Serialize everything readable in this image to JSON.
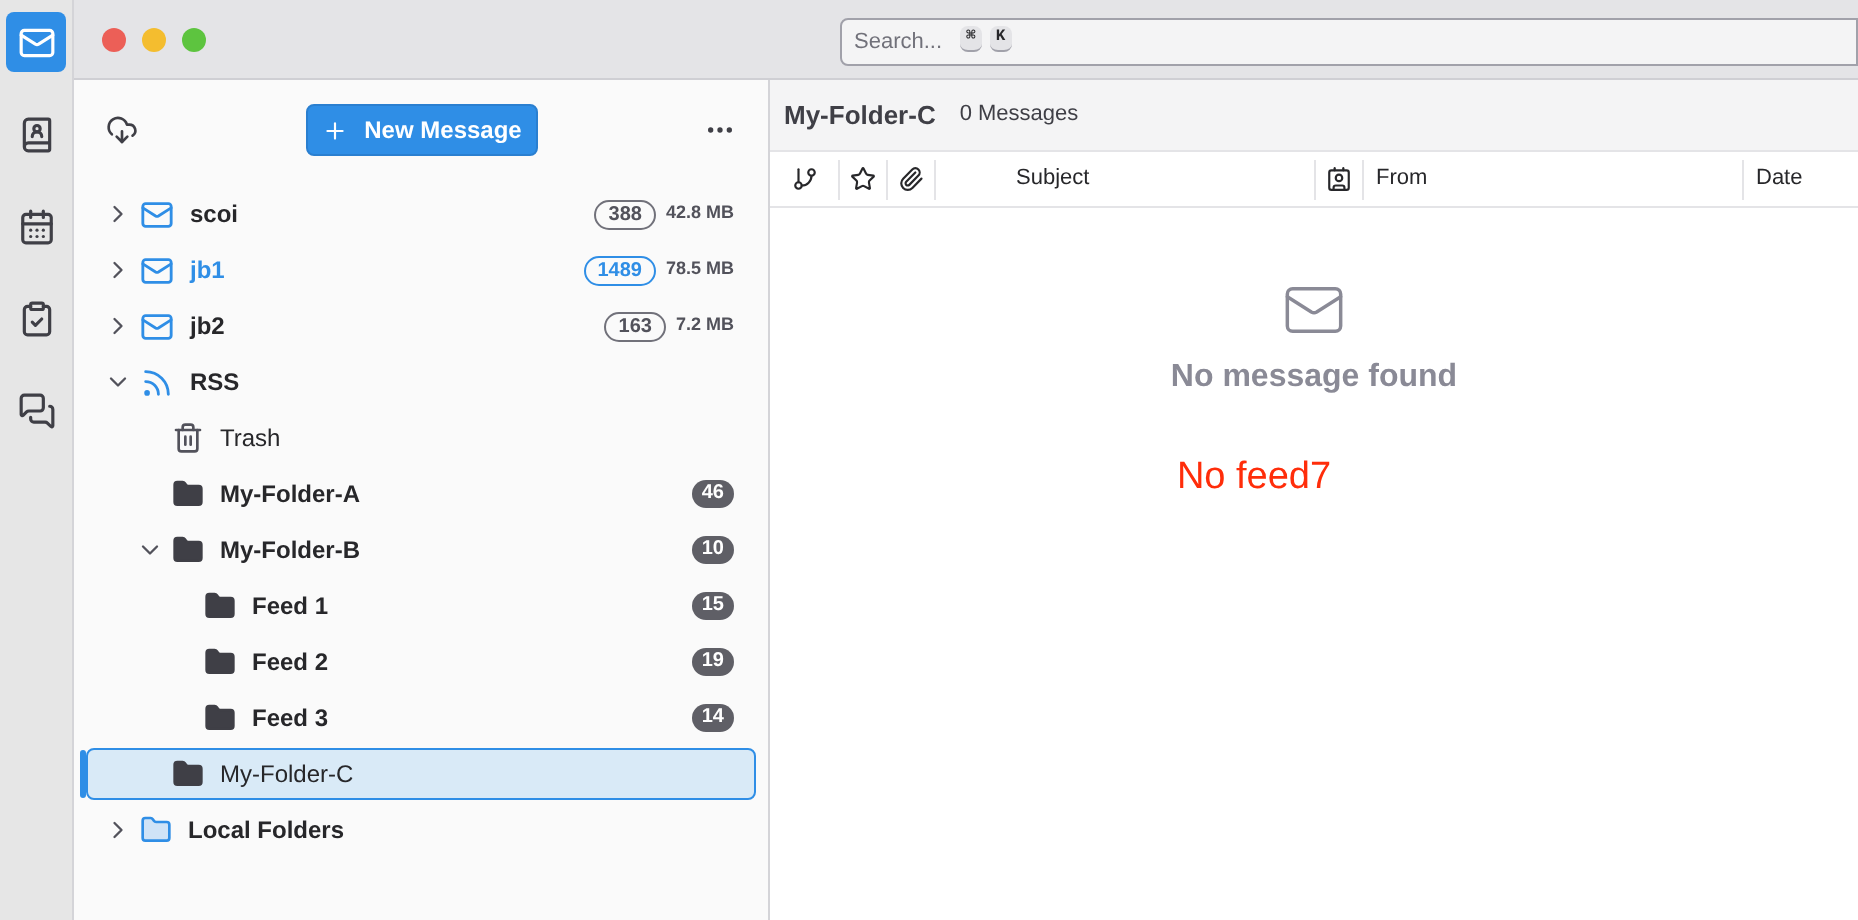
{
  "spaces": [
    {
      "kind": "mail",
      "selected": true
    },
    {
      "kind": "contacts",
      "selected": false
    },
    {
      "kind": "calendar",
      "selected": false
    },
    {
      "kind": "tasks",
      "selected": false
    },
    {
      "kind": "chat",
      "selected": false
    }
  ],
  "search": {
    "placeholder": "Search...",
    "keys": [
      "⌘",
      "K"
    ]
  },
  "folder_pane": {
    "new_message_button": "New Message"
  },
  "tree": [
    {
      "kind": "account",
      "name": "scoi",
      "expanded": false,
      "selected": false,
      "new_mail": false,
      "count": "388",
      "size": "42.8 MB"
    },
    {
      "kind": "account",
      "name": "jb1",
      "expanded": false,
      "selected": false,
      "new_mail": true,
      "count": "1489",
      "size": "78.5 MB"
    },
    {
      "kind": "account",
      "name": "jb2",
      "expanded": false,
      "selected": false,
      "new_mail": false,
      "count": "163",
      "size": "7.2 MB"
    },
    {
      "kind": "rss",
      "name": "RSS",
      "expanded": true,
      "selected": false,
      "new_mail": false,
      "children": [
        {
          "kind": "trash",
          "name": "Trash",
          "selected": false
        },
        {
          "kind": "folder",
          "name": "My-Folder-A",
          "selected": false,
          "count": "46"
        },
        {
          "kind": "folder",
          "name": "My-Folder-B",
          "expanded": true,
          "selected": false,
          "count": "10",
          "children": [
            {
              "kind": "folder",
              "name": "Feed 1",
              "selected": false,
              "count": "15"
            },
            {
              "kind": "folder",
              "name": "Feed 2",
              "selected": false,
              "count": "19"
            },
            {
              "kind": "folder",
              "name": "Feed 3",
              "selected": false,
              "count": "14"
            }
          ]
        },
        {
          "kind": "folder",
          "name": "My-Folder-C",
          "selected": true
        }
      ]
    },
    {
      "kind": "local",
      "name": "Local Folders",
      "expanded": false,
      "selected": false,
      "new_mail": false
    }
  ],
  "message_pane": {
    "folder_title": "My-Folder-C",
    "message_count": "0 Messages",
    "columns": [
      {
        "kind": "thread"
      },
      {
        "kind": "star"
      },
      {
        "kind": "attachment"
      },
      {
        "kind": "text",
        "label": "Subject"
      },
      {
        "kind": "correspondent"
      },
      {
        "kind": "text",
        "label": "From"
      },
      {
        "kind": "text",
        "label": "Date"
      }
    ],
    "empty_text": "No message found",
    "note": "No feed7"
  }
}
